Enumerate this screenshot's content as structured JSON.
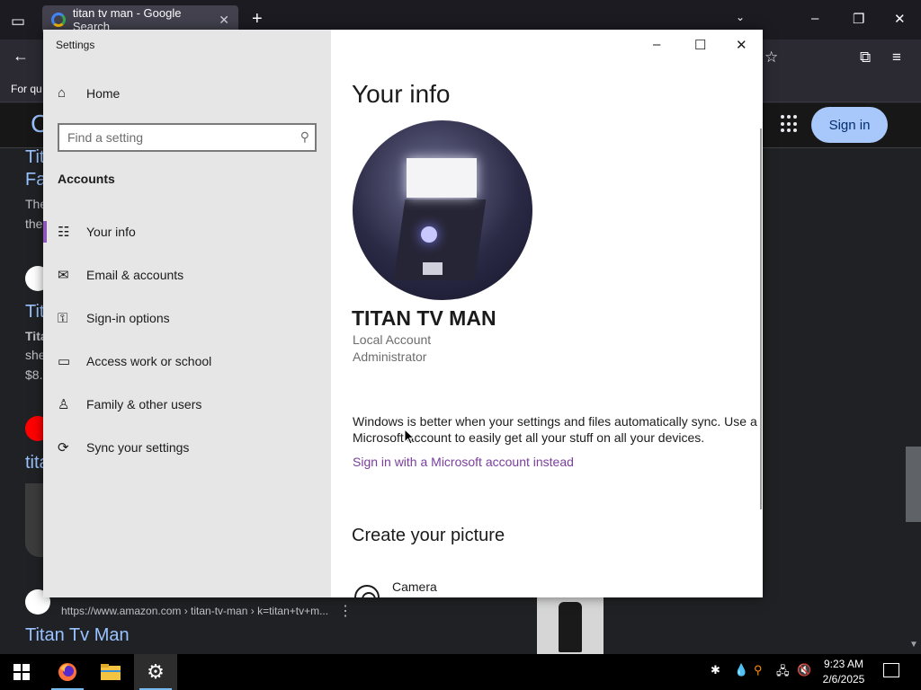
{
  "browser": {
    "tab_title": "titan tv man - Google Search",
    "bookmarks_text": "For qu",
    "signin_label": "Sign in",
    "result_url": "https://www.amazon.com › titan-tv-man › k=titan+tv+m...",
    "result_title": "Titan Tv Man",
    "left_fragments": {
      "frag_a": "C",
      "frag_b1": "Tit",
      "frag_b2": "Fa",
      "frag_c1": "The",
      "frag_c2": "the",
      "frag_d": "Tit",
      "frag_e1": "Tita",
      "frag_e2": "she",
      "frag_e3": "$8.",
      "frag_f": "tita"
    }
  },
  "settings": {
    "window_title": "Settings",
    "home_label": "Home",
    "search_placeholder": "Find a setting",
    "section_label": "Accounts",
    "nav": [
      {
        "label": "Your info",
        "icon": "person-card-icon"
      },
      {
        "label": "Email & accounts",
        "icon": "mail-icon"
      },
      {
        "label": "Sign-in options",
        "icon": "key-icon"
      },
      {
        "label": "Access work or school",
        "icon": "briefcase-icon"
      },
      {
        "label": "Family & other users",
        "icon": "add-person-icon"
      },
      {
        "label": "Sync your settings",
        "icon": "sync-icon"
      }
    ],
    "page_title": "Your info",
    "user_name": "TITAN TV MAN",
    "account_type": "Local Account",
    "account_role": "Administrator",
    "sync_text": "Windows is better when your settings and files automatically sync. Use a Microsoft account to easily get all your stuff on all your devices.",
    "ms_link": "Sign in with a Microsoft account instead",
    "create_picture": "Create your picture",
    "camera_label": "Camera",
    "active_nav_color": "#8e56b8",
    "link_color": "#7a3e9d"
  },
  "taskbar": {
    "time": "9:23 AM",
    "date": "2/6/2025",
    "apps": [
      "firefox-icon",
      "file-explorer-icon",
      "settings-gear-icon"
    ]
  }
}
